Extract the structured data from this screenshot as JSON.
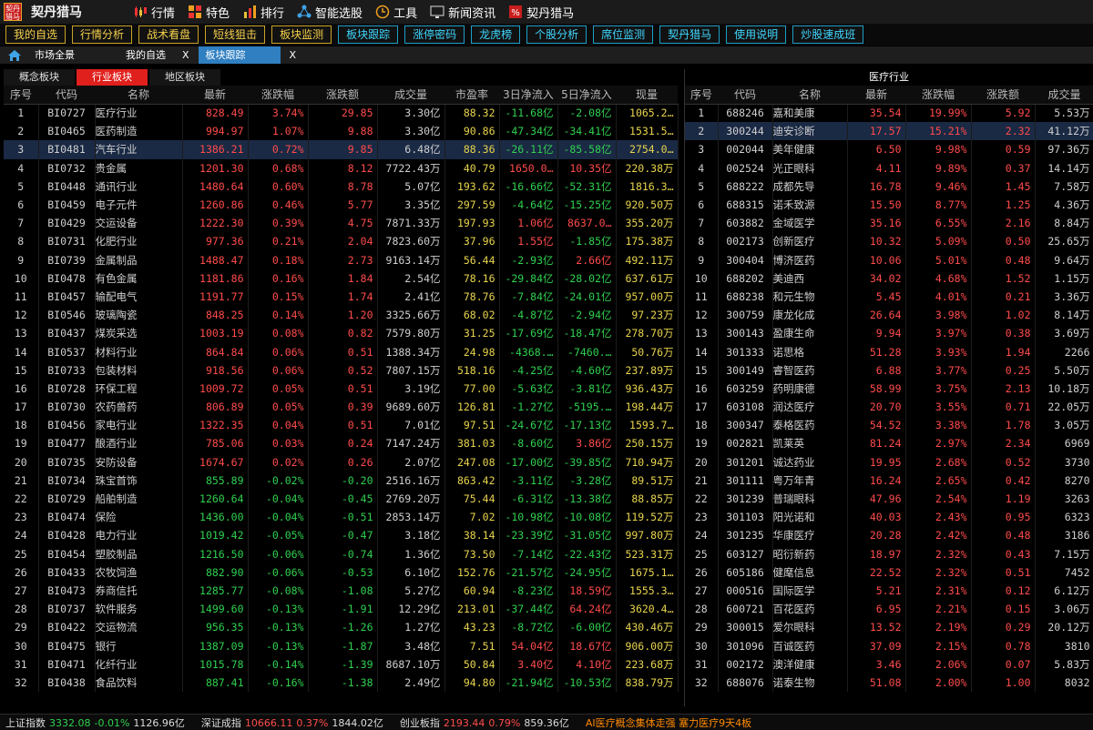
{
  "app": {
    "title": "契丹猎马",
    "logo_text": "契丹猎马"
  },
  "menu": [
    {
      "label": "行情",
      "icon": "candlestick-icon"
    },
    {
      "label": "特色",
      "icon": "grid-icon"
    },
    {
      "label": "排行",
      "icon": "bar-chart-icon"
    },
    {
      "label": "智能选股",
      "icon": "network-icon"
    },
    {
      "label": "工具",
      "icon": "clock-icon"
    },
    {
      "label": "新闻资讯",
      "icon": "monitor-icon"
    },
    {
      "label": "契丹猎马",
      "icon": "percent-icon"
    }
  ],
  "tabs": [
    {
      "label": "我的自选",
      "style": "y"
    },
    {
      "label": "行情分析",
      "style": "y"
    },
    {
      "label": "战术看盘",
      "style": "y"
    },
    {
      "label": "短线狙击",
      "style": "y"
    },
    {
      "label": "板块监测",
      "style": "y"
    },
    {
      "label": "板块跟踪",
      "style": "c"
    },
    {
      "label": "涨停密码",
      "style": "c"
    },
    {
      "label": "龙虎榜",
      "style": "c"
    },
    {
      "label": "个股分析",
      "style": "c"
    },
    {
      "label": "席位监测",
      "style": "c"
    },
    {
      "label": "契丹猎马",
      "style": "c"
    },
    {
      "label": "使用说明",
      "style": "c"
    },
    {
      "label": "炒股速成班",
      "style": "c"
    }
  ],
  "nav": {
    "home": "市场全景",
    "tab1": "我的自选",
    "tab2": "板块跟踪",
    "close": "X"
  },
  "sector_tabs": [
    "概念板块",
    "行业板块",
    "地区板块"
  ],
  "left_headers": [
    "序号",
    "代码",
    "名称",
    "最新",
    "涨跌幅",
    "涨跌额",
    "成交量",
    "市盈率",
    "3日净流入",
    "5日净流入",
    "现量"
  ],
  "left_rows": [
    [
      "1",
      "BI0727",
      "医疗行业",
      "828.49",
      "3.74%",
      "29.85",
      "3.30亿",
      "88.32",
      "-11.68亿",
      "-2.08亿",
      "1065.2…"
    ],
    [
      "2",
      "BI0465",
      "医药制造",
      "994.97",
      "1.07%",
      "9.88",
      "3.30亿",
      "90.86",
      "-47.34亿",
      "-34.41亿",
      "1531.5…"
    ],
    [
      "3",
      "BI0481",
      "汽车行业",
      "1386.21",
      "0.72%",
      "9.85",
      "6.48亿",
      "88.36",
      "-26.11亿",
      "-85.58亿",
      "2754.0…"
    ],
    [
      "4",
      "BI0732",
      "贵金属",
      "1201.30",
      "0.68%",
      "8.12",
      "7722.43万",
      "40.79",
      "1650.0…",
      "10.35亿",
      "220.38万"
    ],
    [
      "5",
      "BI0448",
      "通讯行业",
      "1480.64",
      "0.60%",
      "8.78",
      "5.07亿",
      "193.62",
      "-16.66亿",
      "-52.31亿",
      "1816.3…"
    ],
    [
      "6",
      "BI0459",
      "电子元件",
      "1260.86",
      "0.46%",
      "5.77",
      "3.35亿",
      "297.59",
      "-4.64亿",
      "-15.25亿",
      "920.50万"
    ],
    [
      "7",
      "BI0429",
      "交运设备",
      "1222.30",
      "0.39%",
      "4.75",
      "7871.33万",
      "197.93",
      "1.06亿",
      "8637.0…",
      "355.20万"
    ],
    [
      "8",
      "BI0731",
      "化肥行业",
      "977.36",
      "0.21%",
      "2.04",
      "7823.60万",
      "37.96",
      "1.55亿",
      "-1.85亿",
      "175.38万"
    ],
    [
      "9",
      "BI0739",
      "金属制品",
      "1488.47",
      "0.18%",
      "2.73",
      "9163.14万",
      "56.44",
      "-2.93亿",
      "2.66亿",
      "492.11万"
    ],
    [
      "10",
      "BI0478",
      "有色金属",
      "1181.86",
      "0.16%",
      "1.84",
      "2.54亿",
      "78.16",
      "-29.84亿",
      "-28.02亿",
      "637.61万"
    ],
    [
      "11",
      "BI0457",
      "输配电气",
      "1191.77",
      "0.15%",
      "1.74",
      "2.41亿",
      "78.76",
      "-7.84亿",
      "-24.01亿",
      "957.00万"
    ],
    [
      "12",
      "BI0546",
      "玻璃陶瓷",
      "848.25",
      "0.14%",
      "1.20",
      "3325.66万",
      "68.02",
      "-4.87亿",
      "-2.94亿",
      "97.23万"
    ],
    [
      "13",
      "BI0437",
      "煤炭采选",
      "1003.19",
      "0.08%",
      "0.82",
      "7579.80万",
      "31.25",
      "-17.69亿",
      "-18.47亿",
      "278.70万"
    ],
    [
      "14",
      "BI0537",
      "材料行业",
      "864.84",
      "0.06%",
      "0.51",
      "1388.34万",
      "24.98",
      "-4368.…",
      "-7460.…",
      "50.76万"
    ],
    [
      "15",
      "BI0733",
      "包装材料",
      "918.56",
      "0.06%",
      "0.52",
      "7807.15万",
      "518.16",
      "-4.25亿",
      "-4.60亿",
      "237.89万"
    ],
    [
      "16",
      "BI0728",
      "环保工程",
      "1009.72",
      "0.05%",
      "0.51",
      "3.19亿",
      "77.00",
      "-5.63亿",
      "-3.81亿",
      "936.43万"
    ],
    [
      "17",
      "BI0730",
      "农药兽药",
      "806.89",
      "0.05%",
      "0.39",
      "9689.60万",
      "126.81",
      "-1.27亿",
      "-5195.…",
      "198.44万"
    ],
    [
      "18",
      "BI0456",
      "家电行业",
      "1322.35",
      "0.04%",
      "0.51",
      "7.01亿",
      "97.51",
      "-24.67亿",
      "-17.13亿",
      "1593.7…"
    ],
    [
      "19",
      "BI0477",
      "酿酒行业",
      "785.06",
      "0.03%",
      "0.24",
      "7147.24万",
      "381.03",
      "-8.60亿",
      "3.86亿",
      "250.15万"
    ],
    [
      "20",
      "BI0735",
      "安防设备",
      "1674.67",
      "0.02%",
      "0.26",
      "2.07亿",
      "247.08",
      "-17.00亿",
      "-39.85亿",
      "710.94万"
    ],
    [
      "21",
      "BI0734",
      "珠宝首饰",
      "855.89",
      "-0.02%",
      "-0.20",
      "2516.16万",
      "863.42",
      "-3.11亿",
      "-3.28亿",
      "89.51万"
    ],
    [
      "22",
      "BI0729",
      "船舶制造",
      "1260.64",
      "-0.04%",
      "-0.45",
      "2769.20万",
      "75.44",
      "-6.31亿",
      "-13.38亿",
      "88.85万"
    ],
    [
      "23",
      "BI0474",
      "保险",
      "1436.00",
      "-0.04%",
      "-0.51",
      "2853.14万",
      "7.02",
      "-10.98亿",
      "-10.08亿",
      "119.52万"
    ],
    [
      "24",
      "BI0428",
      "电力行业",
      "1019.42",
      "-0.05%",
      "-0.47",
      "3.18亿",
      "38.14",
      "-23.39亿",
      "-31.05亿",
      "997.80万"
    ],
    [
      "25",
      "BI0454",
      "塑胶制品",
      "1216.50",
      "-0.06%",
      "-0.74",
      "1.36亿",
      "73.50",
      "-7.14亿",
      "-22.43亿",
      "523.31万"
    ],
    [
      "26",
      "BI0433",
      "农牧饲渔",
      "882.90",
      "-0.06%",
      "-0.53",
      "6.10亿",
      "152.76",
      "-21.57亿",
      "-24.95亿",
      "1675.1…"
    ],
    [
      "27",
      "BI0473",
      "券商信托",
      "1285.77",
      "-0.08%",
      "-1.08",
      "5.27亿",
      "60.94",
      "-8.23亿",
      "18.59亿",
      "1555.3…"
    ],
    [
      "28",
      "BI0737",
      "软件服务",
      "1499.60",
      "-0.13%",
      "-1.91",
      "12.29亿",
      "213.01",
      "-37.44亿",
      "64.24亿",
      "3620.4…"
    ],
    [
      "29",
      "BI0422",
      "交运物流",
      "956.35",
      "-0.13%",
      "-1.26",
      "1.27亿",
      "43.23",
      "-8.72亿",
      "-6.00亿",
      "430.46万"
    ],
    [
      "30",
      "BI0475",
      "银行",
      "1387.09",
      "-0.13%",
      "-1.87",
      "3.48亿",
      "7.51",
      "54.04亿",
      "18.67亿",
      "906.00万"
    ],
    [
      "31",
      "BI0471",
      "化纤行业",
      "1015.78",
      "-0.14%",
      "-1.39",
      "8687.10万",
      "50.84",
      "3.40亿",
      "4.10亿",
      "223.68万"
    ],
    [
      "32",
      "BI0438",
      "食品饮料",
      "887.41",
      "-0.16%",
      "-1.38",
      "2.49亿",
      "94.80",
      "-21.94亿",
      "-10.53亿",
      "838.79万"
    ]
  ],
  "right_title": "医疗行业",
  "right_headers": [
    "序号",
    "代码",
    "名称",
    "最新",
    "涨跌幅",
    "涨跌额",
    "成交量"
  ],
  "right_rows": [
    [
      "1",
      "688246",
      "嘉和美康",
      "35.54",
      "19.99%",
      "5.92",
      "5.53万"
    ],
    [
      "2",
      "300244",
      "迪安诊断",
      "17.57",
      "15.21%",
      "2.32",
      "41.12万"
    ],
    [
      "3",
      "002044",
      "美年健康",
      "6.50",
      "9.98%",
      "0.59",
      "97.36万"
    ],
    [
      "4",
      "002524",
      "光正眼科",
      "4.11",
      "9.89%",
      "0.37",
      "14.14万"
    ],
    [
      "5",
      "688222",
      "成都先导",
      "16.78",
      "9.46%",
      "1.45",
      "7.58万"
    ],
    [
      "6",
      "688315",
      "诺禾致源",
      "15.50",
      "8.77%",
      "1.25",
      "4.36万"
    ],
    [
      "7",
      "603882",
      "金域医学",
      "35.16",
      "6.55%",
      "2.16",
      "8.84万"
    ],
    [
      "8",
      "002173",
      "创新医疗",
      "10.32",
      "5.09%",
      "0.50",
      "25.65万"
    ],
    [
      "9",
      "300404",
      "博济医药",
      "10.06",
      "5.01%",
      "0.48",
      "9.64万"
    ],
    [
      "10",
      "688202",
      "美迪西",
      "34.02",
      "4.68%",
      "1.52",
      "1.15万"
    ],
    [
      "11",
      "688238",
      "和元生物",
      "5.45",
      "4.01%",
      "0.21",
      "3.36万"
    ],
    [
      "12",
      "300759",
      "康龙化成",
      "26.64",
      "3.98%",
      "1.02",
      "8.14万"
    ],
    [
      "13",
      "300143",
      "盈康生命",
      "9.94",
      "3.97%",
      "0.38",
      "3.69万"
    ],
    [
      "14",
      "301333",
      "诺思格",
      "51.28",
      "3.93%",
      "1.94",
      "2266"
    ],
    [
      "15",
      "300149",
      "睿智医药",
      "6.88",
      "3.77%",
      "0.25",
      "5.50万"
    ],
    [
      "16",
      "603259",
      "药明康德",
      "58.99",
      "3.75%",
      "2.13",
      "10.18万"
    ],
    [
      "17",
      "603108",
      "润达医疗",
      "20.70",
      "3.55%",
      "0.71",
      "22.05万"
    ],
    [
      "18",
      "300347",
      "泰格医药",
      "54.52",
      "3.38%",
      "1.78",
      "3.05万"
    ],
    [
      "19",
      "002821",
      "凯莱英",
      "81.24",
      "2.97%",
      "2.34",
      "6969"
    ],
    [
      "20",
      "301201",
      "诚达药业",
      "19.95",
      "2.68%",
      "0.52",
      "3730"
    ],
    [
      "21",
      "301111",
      "粤万年青",
      "16.24",
      "2.65%",
      "0.42",
      "8270"
    ],
    [
      "22",
      "301239",
      "普瑞眼科",
      "47.96",
      "2.54%",
      "1.19",
      "3263"
    ],
    [
      "23",
      "301103",
      "阳光诺和",
      "40.03",
      "2.43%",
      "0.95",
      "6323"
    ],
    [
      "24",
      "301235",
      "华康医疗",
      "20.28",
      "2.42%",
      "0.48",
      "3186"
    ],
    [
      "25",
      "603127",
      "昭衍新药",
      "18.97",
      "2.32%",
      "0.43",
      "7.15万"
    ],
    [
      "26",
      "605186",
      "健麾信息",
      "22.52",
      "2.32%",
      "0.51",
      "7452"
    ],
    [
      "27",
      "000516",
      "国际医学",
      "5.21",
      "2.31%",
      "0.12",
      "6.12万"
    ],
    [
      "28",
      "600721",
      "百花医药",
      "6.95",
      "2.21%",
      "0.15",
      "3.06万"
    ],
    [
      "29",
      "300015",
      "爱尔眼科",
      "13.52",
      "2.19%",
      "0.29",
      "20.12万"
    ],
    [
      "30",
      "301096",
      "百诚医药",
      "37.09",
      "2.15%",
      "0.78",
      "3810"
    ],
    [
      "31",
      "002172",
      "澳洋健康",
      "3.46",
      "2.06%",
      "0.07",
      "5.83万"
    ],
    [
      "32",
      "688076",
      "诺泰生物",
      "51.08",
      "2.00%",
      "1.00",
      "8032"
    ]
  ],
  "status": {
    "sh_name": "上证指数",
    "sh_price": "3332.08",
    "sh_chg": "-0.01%",
    "sh_amt": "1126.96亿",
    "sz_name": "深证成指",
    "sz_price": "10666.11",
    "sz_chg": "0.37%",
    "sz_amt": "1844.02亿",
    "cy_name": "创业板指",
    "cy_price": "2193.44",
    "cy_chg": "0.79%",
    "cy_amt": "859.36亿",
    "news": "AI医疗概念集体走强 塞力医疗9天4板"
  },
  "colors": {
    "up": "#ff4b4b",
    "down": "#2fd14f",
    "pe": "#e8d44d",
    "accent": "#2f7fc1",
    "active_tab": "#e0201c"
  }
}
